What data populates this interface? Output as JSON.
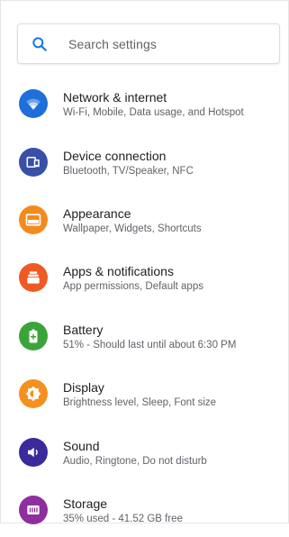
{
  "search": {
    "placeholder": "Search settings",
    "icon": "search-icon",
    "icon_color": "#1a73e8"
  },
  "settings": [
    {
      "title": "Network & internet",
      "subtitle": "Wi-Fi, Mobile, Data usage, and Hotspot",
      "icon": "wifi-icon",
      "color": "#1e6fd9"
    },
    {
      "title": "Device connection",
      "subtitle": "Bluetooth, TV/Speaker, NFC",
      "icon": "device-connection-icon",
      "color": "#3950a8"
    },
    {
      "title": "Appearance",
      "subtitle": "Wallpaper, Widgets, Shortcuts",
      "icon": "wallpaper-icon",
      "color": "#f28b1e"
    },
    {
      "title": "Apps & notifications",
      "subtitle": "App permissions, Default apps",
      "icon": "apps-icon",
      "color": "#ef5a24"
    },
    {
      "title": "Battery",
      "subtitle": "51% - Should last until about 6:30 PM",
      "icon": "battery-icon",
      "color": "#3aa43a"
    },
    {
      "title": "Display",
      "subtitle": "Brightness level, Sleep, Font size",
      "icon": "brightness-icon",
      "color": "#f5901e"
    },
    {
      "title": "Sound",
      "subtitle": "Audio, Ringtone, Do not disturb",
      "icon": "volume-icon",
      "color": "#3b2a9b"
    },
    {
      "title": "Storage",
      "subtitle": "35% used - 41.52 GB free",
      "icon": "storage-icon",
      "color": "#8e2f9e"
    }
  ]
}
